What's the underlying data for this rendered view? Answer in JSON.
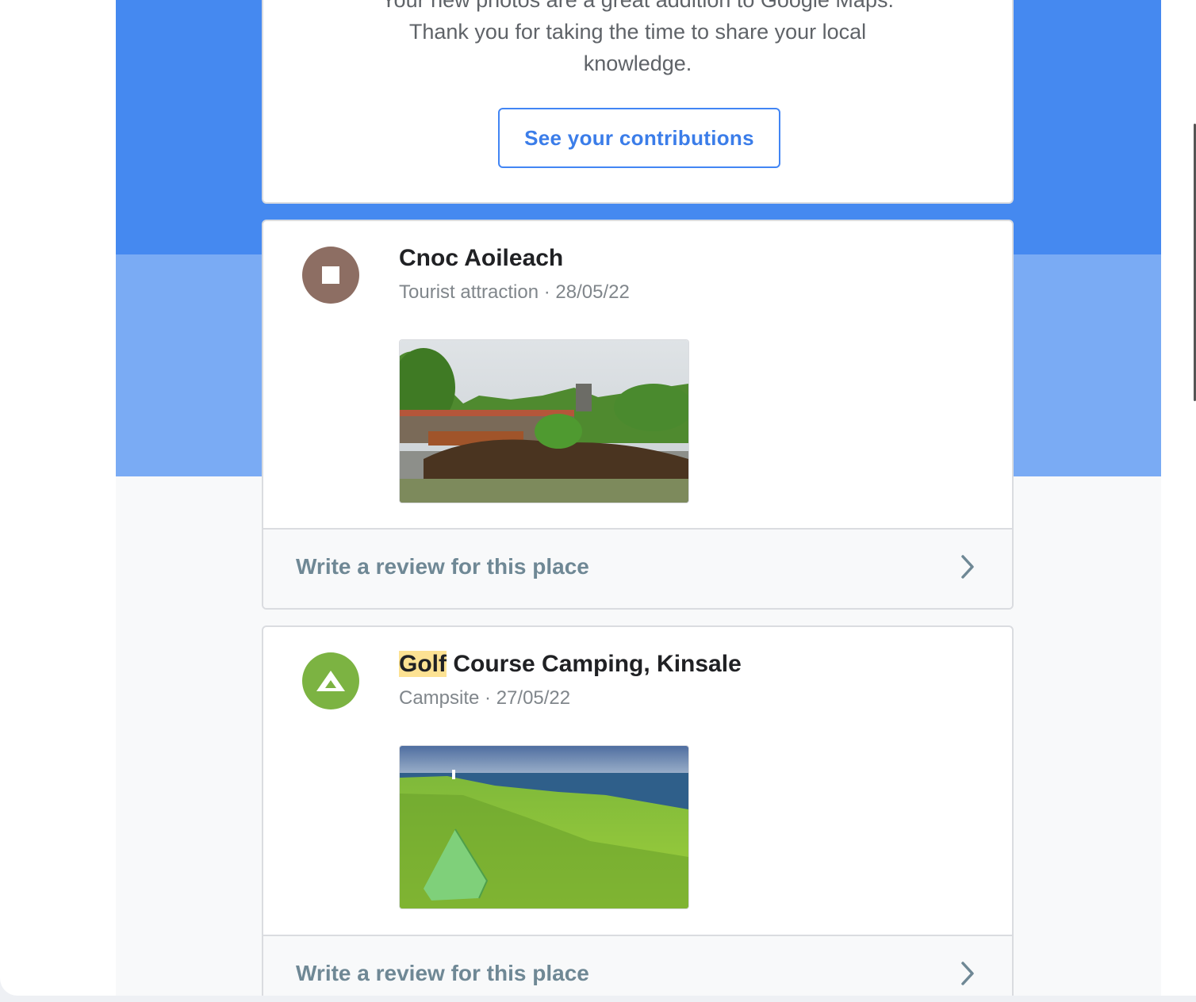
{
  "confirmation": {
    "lines": [
      "Your new photos are a great addition to Google Maps.",
      "Thank you for taking the time to share your local",
      "knowledge."
    ],
    "cta_label": "See your contributions"
  },
  "places": [
    {
      "name_highlight": "",
      "name_rest": "Cnoc Aoileach",
      "category": "Tourist attraction",
      "separator": " · ",
      "date": "28/05/22",
      "icon": "square-icon",
      "icon_color": "#8d6e63",
      "review_label": "Write a review for this place"
    },
    {
      "name_highlight": "Golf",
      "name_rest": " Course Camping, Kinsale",
      "category": "Campsite",
      "separator": " · ",
      "date": "27/05/22",
      "icon": "tent-icon",
      "icon_color": "#7cb342",
      "review_label": "Write a review for this place"
    }
  ],
  "colors": {
    "band_dark": "#4589f0",
    "band_light": "#7aabf4",
    "link_blue": "#3b7de9",
    "review_text": "#6f8895"
  }
}
